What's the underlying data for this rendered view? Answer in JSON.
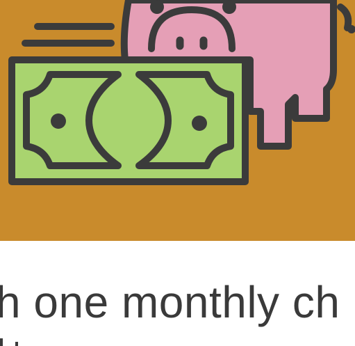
{
  "colors": {
    "background": "#c98b2c",
    "outline": "#3b3b3b",
    "banknote": "#a9d46f",
    "piggy": "#e59fb6",
    "text": "#3a3a3a"
  },
  "illustration": {
    "icons": [
      "piggy-bank-icon",
      "banknote-icon",
      "speed-lines-icon"
    ]
  },
  "headline": {
    "text": "h one monthly ch"
  }
}
